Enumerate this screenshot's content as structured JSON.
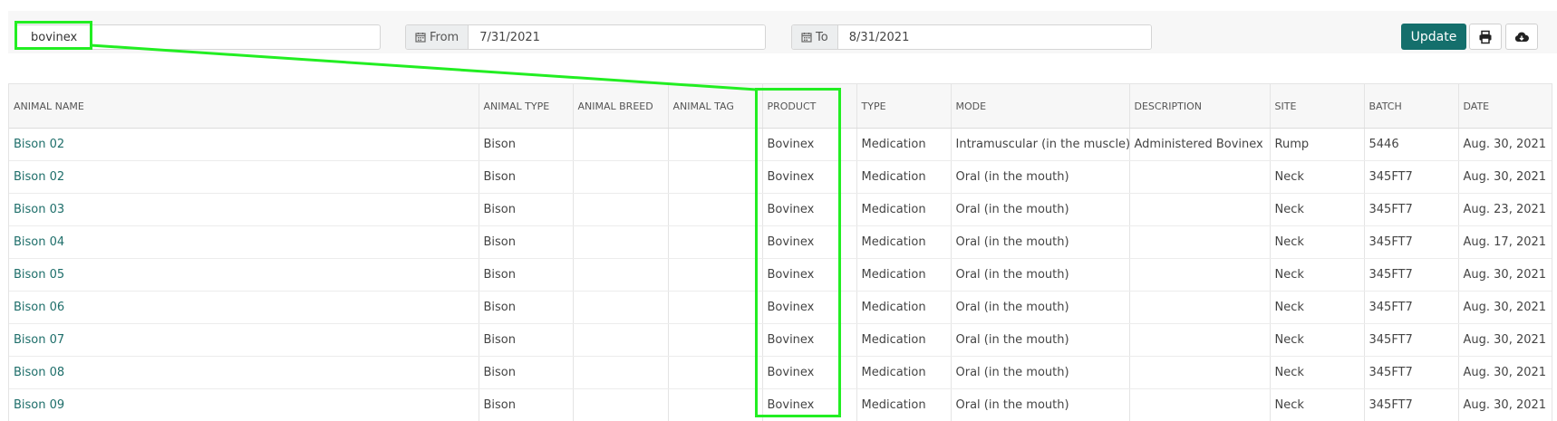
{
  "toolbar": {
    "search_value": "bovinex",
    "from_label": "From",
    "from_value": "7/31/2021",
    "to_label": "To",
    "to_value": "8/31/2021",
    "update_label": "Update"
  },
  "icons": {
    "calendar": "calendar-icon",
    "print": "print-icon",
    "download": "cloud-download-icon"
  },
  "colors": {
    "accent": "#146f6c",
    "link": "#1e6e6a",
    "highlight": "#22ee22"
  },
  "table": {
    "headers": [
      "ANIMAL NAME",
      "ANIMAL TYPE",
      "ANIMAL BREED",
      "ANIMAL TAG",
      "PRODUCT",
      "TYPE",
      "MODE",
      "DESCRIPTION",
      "SITE",
      "BATCH",
      "DATE"
    ],
    "rows": [
      [
        "Bison 02",
        "Bison",
        "",
        "",
        "Bovinex",
        "Medication",
        "Intramuscular (in the muscle)",
        "Administered Bovinex",
        "Rump",
        "5446",
        "Aug. 30, 2021"
      ],
      [
        "Bison 02",
        "Bison",
        "",
        "",
        "Bovinex",
        "Medication",
        "Oral (in the mouth)",
        "",
        "Neck",
        "345FT7",
        "Aug. 30, 2021"
      ],
      [
        "Bison 03",
        "Bison",
        "",
        "",
        "Bovinex",
        "Medication",
        "Oral (in the mouth)",
        "",
        "Neck",
        "345FT7",
        "Aug. 23, 2021"
      ],
      [
        "Bison 04",
        "Bison",
        "",
        "",
        "Bovinex",
        "Medication",
        "Oral (in the mouth)",
        "",
        "Neck",
        "345FT7",
        "Aug. 17, 2021"
      ],
      [
        "Bison 05",
        "Bison",
        "",
        "",
        "Bovinex",
        "Medication",
        "Oral (in the mouth)",
        "",
        "Neck",
        "345FT7",
        "Aug. 30, 2021"
      ],
      [
        "Bison 06",
        "Bison",
        "",
        "",
        "Bovinex",
        "Medication",
        "Oral (in the mouth)",
        "",
        "Neck",
        "345FT7",
        "Aug. 30, 2021"
      ],
      [
        "Bison 07",
        "Bison",
        "",
        "",
        "Bovinex",
        "Medication",
        "Oral (in the mouth)",
        "",
        "Neck",
        "345FT7",
        "Aug. 30, 2021"
      ],
      [
        "Bison 08",
        "Bison",
        "",
        "",
        "Bovinex",
        "Medication",
        "Oral (in the mouth)",
        "",
        "Neck",
        "345FT7",
        "Aug. 30, 2021"
      ],
      [
        "Bison 09",
        "Bison",
        "",
        "",
        "Bovinex",
        "Medication",
        "Oral (in the mouth)",
        "",
        "Neck",
        "345FT7",
        "Aug. 30, 2021"
      ]
    ]
  }
}
